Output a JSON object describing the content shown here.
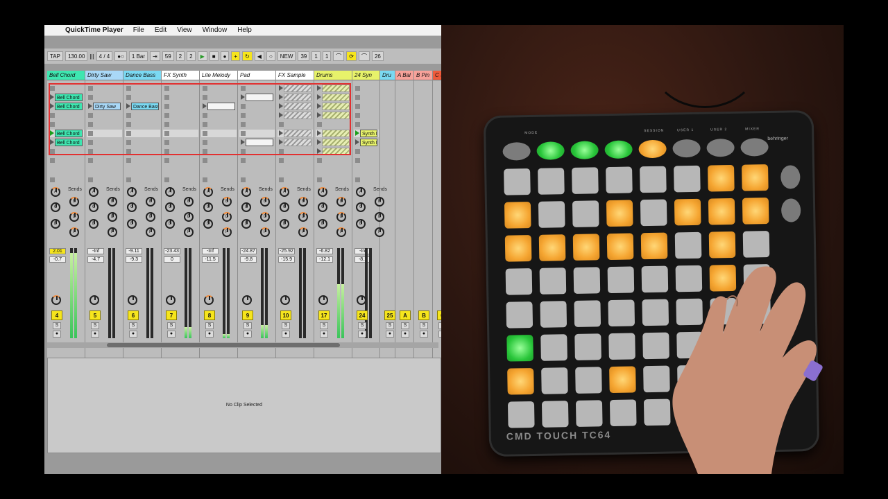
{
  "menubar": {
    "apple": "",
    "app": "QuickTime Player",
    "items": [
      "File",
      "Edit",
      "View",
      "Window",
      "Help"
    ]
  },
  "transport": {
    "tap": "TAP",
    "tempo": "130.00",
    "meter_sep": "|||",
    "sig": "4 / 4",
    "rec_dots": "●○",
    "quant": "1 Bar",
    "pos_a": "59",
    "pos_b": "2",
    "pos_c": "2",
    "new": "NEW",
    "loop_a": "39",
    "loop_b": "1",
    "loop_c": "1",
    "end": "26"
  },
  "tracks": [
    {
      "name": "Bell Chord",
      "color": "#3ee6b0",
      "num": "4",
      "vol": "2.01",
      "pan": "-0.7",
      "vol_yellow": true
    },
    {
      "name": "Dirty Saw",
      "color": "#a9d8f7",
      "num": "5",
      "vol": "-Inf",
      "pan": "-4.7"
    },
    {
      "name": "Dance Bass",
      "color": "#7ad9f2",
      "num": "6",
      "vol": "-9.11",
      "pan": "-9.3"
    },
    {
      "name": "FX Synth",
      "color": "#ffffff",
      "num": "7",
      "vol": "-23.43",
      "pan": "0"
    },
    {
      "name": "Lite Melody",
      "color": "#ffffff",
      "num": "8",
      "vol": "-Inf",
      "pan": "-11.5"
    },
    {
      "name": "Pad",
      "color": "#ffffff",
      "num": "9",
      "vol": "-24.87",
      "pan": "-9.8"
    },
    {
      "name": "FX Sample",
      "color": "#ffffff",
      "num": "10",
      "vol": "-25.92",
      "pan": "-15.9"
    },
    {
      "name": "Drums",
      "color": "#e7f26a",
      "num": "17",
      "vol": "-6.82",
      "pan": "-12.1"
    },
    {
      "name": "24 Syn",
      "color": "#e7f26a",
      "num": "24",
      "vol": "-Inf",
      "pan": "-8.1"
    },
    {
      "name": "Dru",
      "color": "#7ad9f2",
      "num": "25",
      "vol": "-4",
      "pan": "-4.3"
    },
    {
      "name": "A Bal",
      "color": "#f7a29a",
      "num": "A",
      "vol": "",
      "pan": ""
    },
    {
      "name": "B Pin",
      "color": "#f7a29a",
      "num": "B",
      "vol": "",
      "pan": ""
    },
    {
      "name": "C Si",
      "color": "#ef5a3a",
      "num": "C",
      "vol": "",
      "pan": ""
    }
  ],
  "clips": {
    "bell": "Bell Chord",
    "dirty": "Dirty Saw",
    "dance": "Dance Bass",
    "synth": "Synth D"
  },
  "mixer": {
    "sends": "Sends",
    "send_letters": [
      "A",
      "B",
      "C",
      "D",
      "E",
      "F"
    ],
    "inf": "-inf",
    "sixtyfive": "-65.0",
    "solo": "S",
    "counter_a": "1",
    "counter_b": "32",
    "counter_c": "1",
    "counter_d": "2",
    "box_58": "58",
    "box_10": "10"
  },
  "detail": {
    "empty": "No Clip Selected"
  },
  "device": {
    "name": "CMD TOUCH TC64",
    "brand": "behringer",
    "mode": "MODE",
    "session": "SESSION",
    "user1": "USER 1",
    "user2": "USER 2",
    "mixer": "MIXER"
  },
  "colors": {
    "accent_green": "#29c63a",
    "accent_orange": "#f5a531"
  }
}
